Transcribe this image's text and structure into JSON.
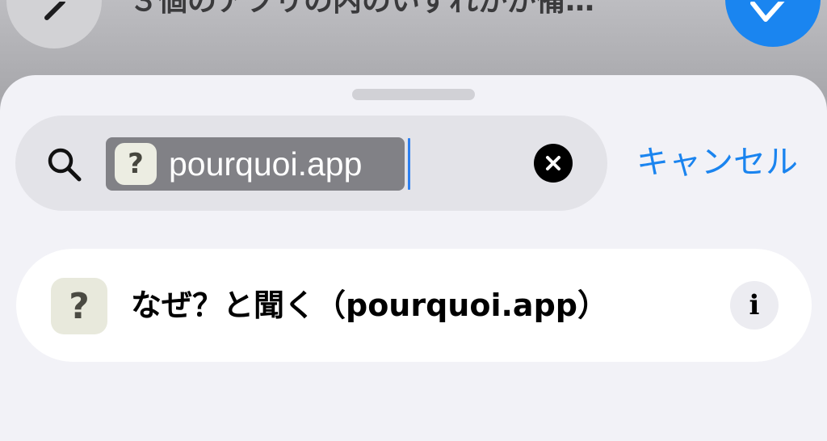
{
  "background": {
    "title": "３個のアプリの内のいずれかが備…",
    "back_icon": "chevron-left-icon",
    "confirm_icon": "checkmark-icon"
  },
  "search": {
    "icon": "search-icon",
    "token_app_icon_glyph": "?",
    "token_label": "pourquoi.app",
    "clear_icon": "clear-icon",
    "cancel_label": "キャンセル"
  },
  "results": [
    {
      "app_icon_glyph": "?",
      "label": "なぜ？と聞く（pourquoi.app）",
      "info_glyph": "i"
    }
  ],
  "colors": {
    "accent": "#1a84ef",
    "confirm_button": "#1a85f0",
    "token_background": "#818186"
  }
}
